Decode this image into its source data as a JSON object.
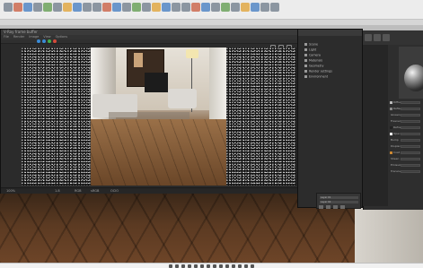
{
  "host": {
    "toolbar_icons": 28,
    "taskbar_icons": 14
  },
  "render_window": {
    "title": "V-Ray frame buffer",
    "menus": [
      "File",
      "Render",
      "Image",
      "View",
      "Options"
    ],
    "status": {
      "left": "100%",
      "mid1": "1.8",
      "mid2": "RGB",
      "mid3": "sRGB",
      "mid4": "OCIO"
    },
    "toolbar_colors": [
      "#3a8bd6",
      "#3a8bd6",
      "#42b04a",
      "#d44a3a"
    ]
  },
  "scene_window": {
    "items": [
      "Scene",
      "Light",
      "Camera",
      "Materials",
      "Geometry",
      "Render settings",
      "Environment"
    ],
    "bottom_rows": [
      "Layer 01",
      "Layer 02"
    ]
  },
  "material_editor": {
    "props": [
      {
        "label": "Diffuse",
        "swatch": "#bbbbbb"
      },
      {
        "label": "Reflection",
        "swatch": "#888888"
      },
      {
        "label": "Glossiness",
        "swatch": ""
      },
      {
        "label": "Fresnel IOR",
        "swatch": ""
      },
      {
        "label": "Refraction",
        "swatch": "#222222"
      },
      {
        "label": "Opacity",
        "swatch": "#ffffff"
      },
      {
        "label": "Bump",
        "swatch": ""
      },
      {
        "label": "Displacement",
        "swatch": ""
      },
      {
        "label": "Coat",
        "swatch": "#cc8833"
      },
      {
        "label": "Sheen",
        "swatch": ""
      },
      {
        "label": "Emission",
        "swatch": ""
      },
      {
        "label": "Translucency",
        "swatch": ""
      }
    ],
    "preview_bg": "#3c3c3c"
  }
}
